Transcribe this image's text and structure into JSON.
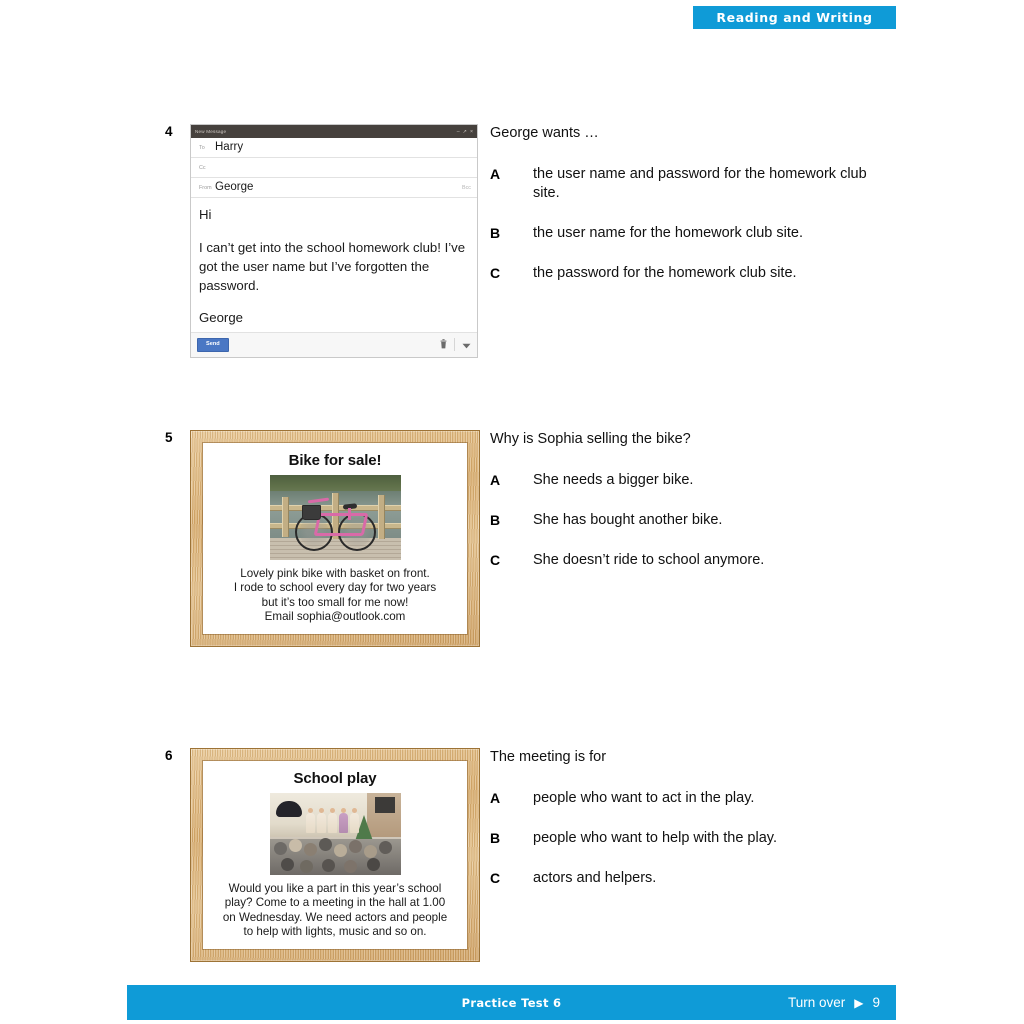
{
  "header": {
    "banner_label": "Reading and Writing",
    "banner_color": "#0f9bd7"
  },
  "questions": [
    {
      "number": "4",
      "stem": "George wants …",
      "options": [
        {
          "letter": "A",
          "text": "the user name and password for the homework club site."
        },
        {
          "letter": "B",
          "text": "the user name for the homework club site."
        },
        {
          "letter": "C",
          "text": "the password for the homework club site."
        }
      ],
      "stimulus_type": "email",
      "email": {
        "window_title": "New Message",
        "minimize_glyph": "–",
        "maximize_glyph": "↗",
        "close_glyph": "×",
        "to_label": "To",
        "to_value": "Harry",
        "cc_label": "Cc",
        "cc_value": "",
        "from_label": "From",
        "from_value": "George",
        "bcc_label": "Bcc",
        "body_line1": "Hi",
        "body_line2": "I can’t get into the school homework club! I’ve got the user name but I’ve forgotten the password.",
        "body_line3": "George",
        "send_label": "Send",
        "trash_glyph": "Ὕ1",
        "more_glyph": "▼",
        "send_color": "#4a77c4"
      }
    },
    {
      "number": "5",
      "stem": "Why is Sophia selling the bike?",
      "options": [
        {
          "letter": "A",
          "text": "She needs a bigger bike."
        },
        {
          "letter": "B",
          "text": "She has bought another bike."
        },
        {
          "letter": "C",
          "text": "She doesn’t ride to school anymore."
        }
      ],
      "stimulus_type": "poster",
      "poster": {
        "title": "Bike for sale!",
        "photo_caption": "pink bike with basket leaning on wooden railing over water",
        "lines": [
          "Lovely pink bike with basket on front.",
          "I rode to school every day for two years",
          "but it’s too small for me now!",
          "Email sophia@outlook.com"
        ]
      }
    },
    {
      "number": "6",
      "stem": "The meeting is for",
      "options": [
        {
          "letter": "A",
          "text": "people who want to act in the play."
        },
        {
          "letter": "B",
          "text": "people who want to help with the play."
        },
        {
          "letter": "C",
          "text": "actors and helpers."
        }
      ],
      "stimulus_type": "poster",
      "poster": {
        "title": "School play",
        "photo_caption": "children performing on a school hall stage in front of a seated audience",
        "lines": [
          "Would you like a part in this year’s school",
          "play? Come to a meeting in the hall at 1.00",
          "on Wednesday. We need actors and people",
          "to help with lights, music and so on."
        ]
      }
    }
  ],
  "footer": {
    "test_label": "Practice Test 6",
    "turn_over_label": "Turn over",
    "turn_over_arrow": "▶",
    "page_number": "9",
    "bar_color": "#0f9bd7"
  }
}
